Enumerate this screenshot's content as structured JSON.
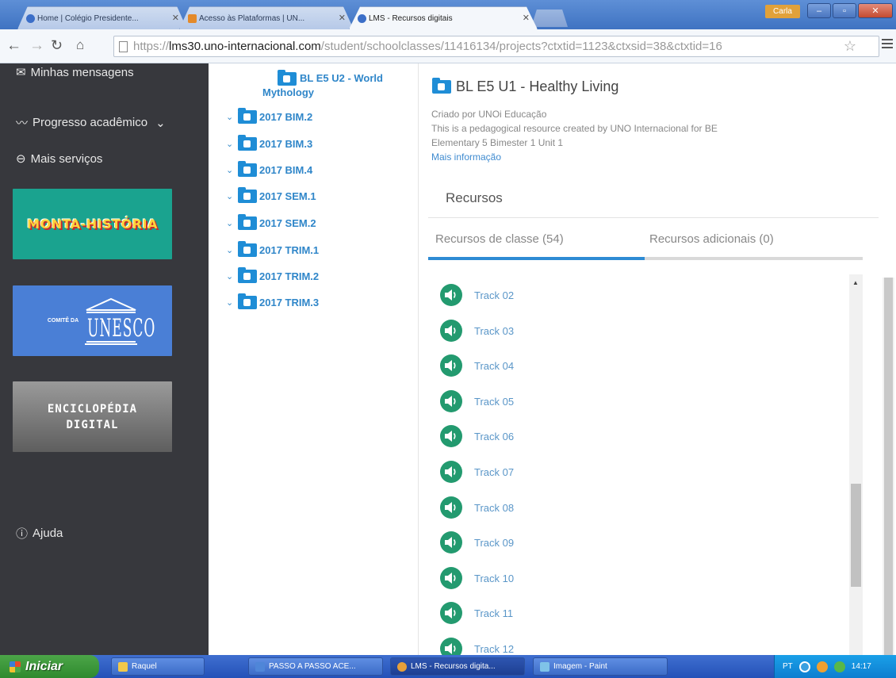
{
  "browser": {
    "tabs": [
      {
        "label": "Home | Colégio Presidente..."
      },
      {
        "label": "Acesso às Plataformas | UN..."
      },
      {
        "label": "LMS - Recursos digitais"
      }
    ],
    "user_label": "Carla",
    "url_prefix": "https://",
    "url_domain": "lms30.uno-internacional.com",
    "url_rest": "/student/schoolclasses/11416134/projects?ctxtid=1123&ctxsid=38&ctxtid=16"
  },
  "sidebar": {
    "messages_label": "Minhas mensagens",
    "progress_label": "Progresso acadêmico",
    "services_label": "Mais serviços",
    "help_label": "Ajuda",
    "banners": {
      "monta": "MONTA-HISTÓRIA",
      "unesco_small": "COMITÊ DA",
      "unesco": "UNESCO",
      "enciclo_line1": "ENCICLOPÉDIA",
      "enciclo_line2": "DIGITAL"
    }
  },
  "tree": {
    "root_label_1": "BL E5 U2 - World",
    "root_label_2": "Mythology",
    "items": [
      {
        "label": "2017 BIM.2"
      },
      {
        "label": "2017 BIM.3"
      },
      {
        "label": "2017 BIM.4"
      },
      {
        "label": "2017 SEM.1"
      },
      {
        "label": "2017 SEM.2"
      },
      {
        "label": "2017 TRIM.1"
      },
      {
        "label": "2017 TRIM.2"
      },
      {
        "label": "2017 TRIM.3"
      }
    ]
  },
  "main": {
    "title": "BL E5 U1 - Healthy Living",
    "created_by": "Criado por UNOi Educação",
    "description_1": "This is a pedagogical resource created by UNO Internacional for BE",
    "description_2": "Elementary 5 Bimester 1 Unit 1",
    "more_info": "Mais informação",
    "section_title": "Recursos",
    "tab_class": "Recursos de classe (54)",
    "tab_extra": "Recursos adicionais (0)",
    "tracks": [
      "Track 02",
      "Track 03",
      "Track 04",
      "Track 05",
      "Track 06",
      "Track 07",
      "Track 08",
      "Track 09",
      "Track 10",
      "Track 11",
      "Track 12"
    ]
  },
  "taskbar": {
    "start_label": "Iniciar",
    "tasks": [
      {
        "label": "Raquel"
      },
      {
        "label": "PASSO A PASSO ACE..."
      },
      {
        "label": "LMS - Recursos digita..."
      },
      {
        "label": "Imagem - Paint"
      }
    ],
    "lang": "PT",
    "clock": "14:17"
  },
  "colors": {
    "sidebar_bg": "#37383d",
    "accent": "#2e8bd4",
    "track_icon": "#239a6f",
    "monta_banner": "#1aa38f",
    "unesco_banner": "#4a7fd6"
  }
}
